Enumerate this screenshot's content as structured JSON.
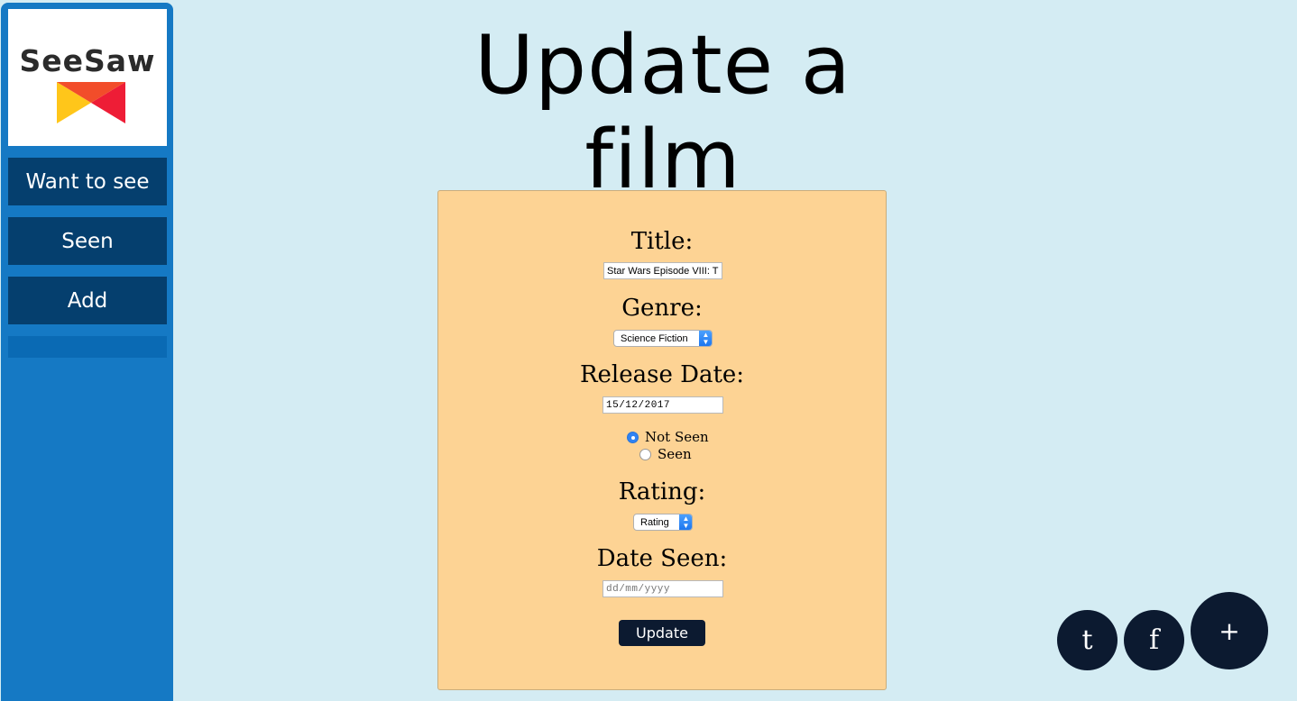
{
  "brand": {
    "name": "SeeSaw",
    "accent": "#1579c4",
    "nav_bg": "#053f6e"
  },
  "sidebar": {
    "items": [
      {
        "label": "Want to see"
      },
      {
        "label": "Seen"
      },
      {
        "label": "Add"
      }
    ]
  },
  "page": {
    "title": "Update a film",
    "background": "#d4ecf3"
  },
  "form": {
    "background": "#fdd394",
    "title_label": "Title:",
    "title_value": "Star Wars Episode VIII: T",
    "genre_label": "Genre:",
    "genre_value": "Science Fiction",
    "release_label": "Release Date:",
    "release_value": "15/12/2017",
    "seen_status": {
      "options": [
        {
          "label": "Not Seen",
          "checked": true
        },
        {
          "label": "Seen",
          "checked": false
        }
      ]
    },
    "rating_label": "Rating:",
    "rating_value": "Rating",
    "date_seen_label": "Date Seen:",
    "date_seen_value": "dd/mm/yyyy",
    "submit_label": "Update"
  },
  "floating_actions": {
    "tumblr_label": "t",
    "facebook_label": "f",
    "add_label": "+"
  }
}
